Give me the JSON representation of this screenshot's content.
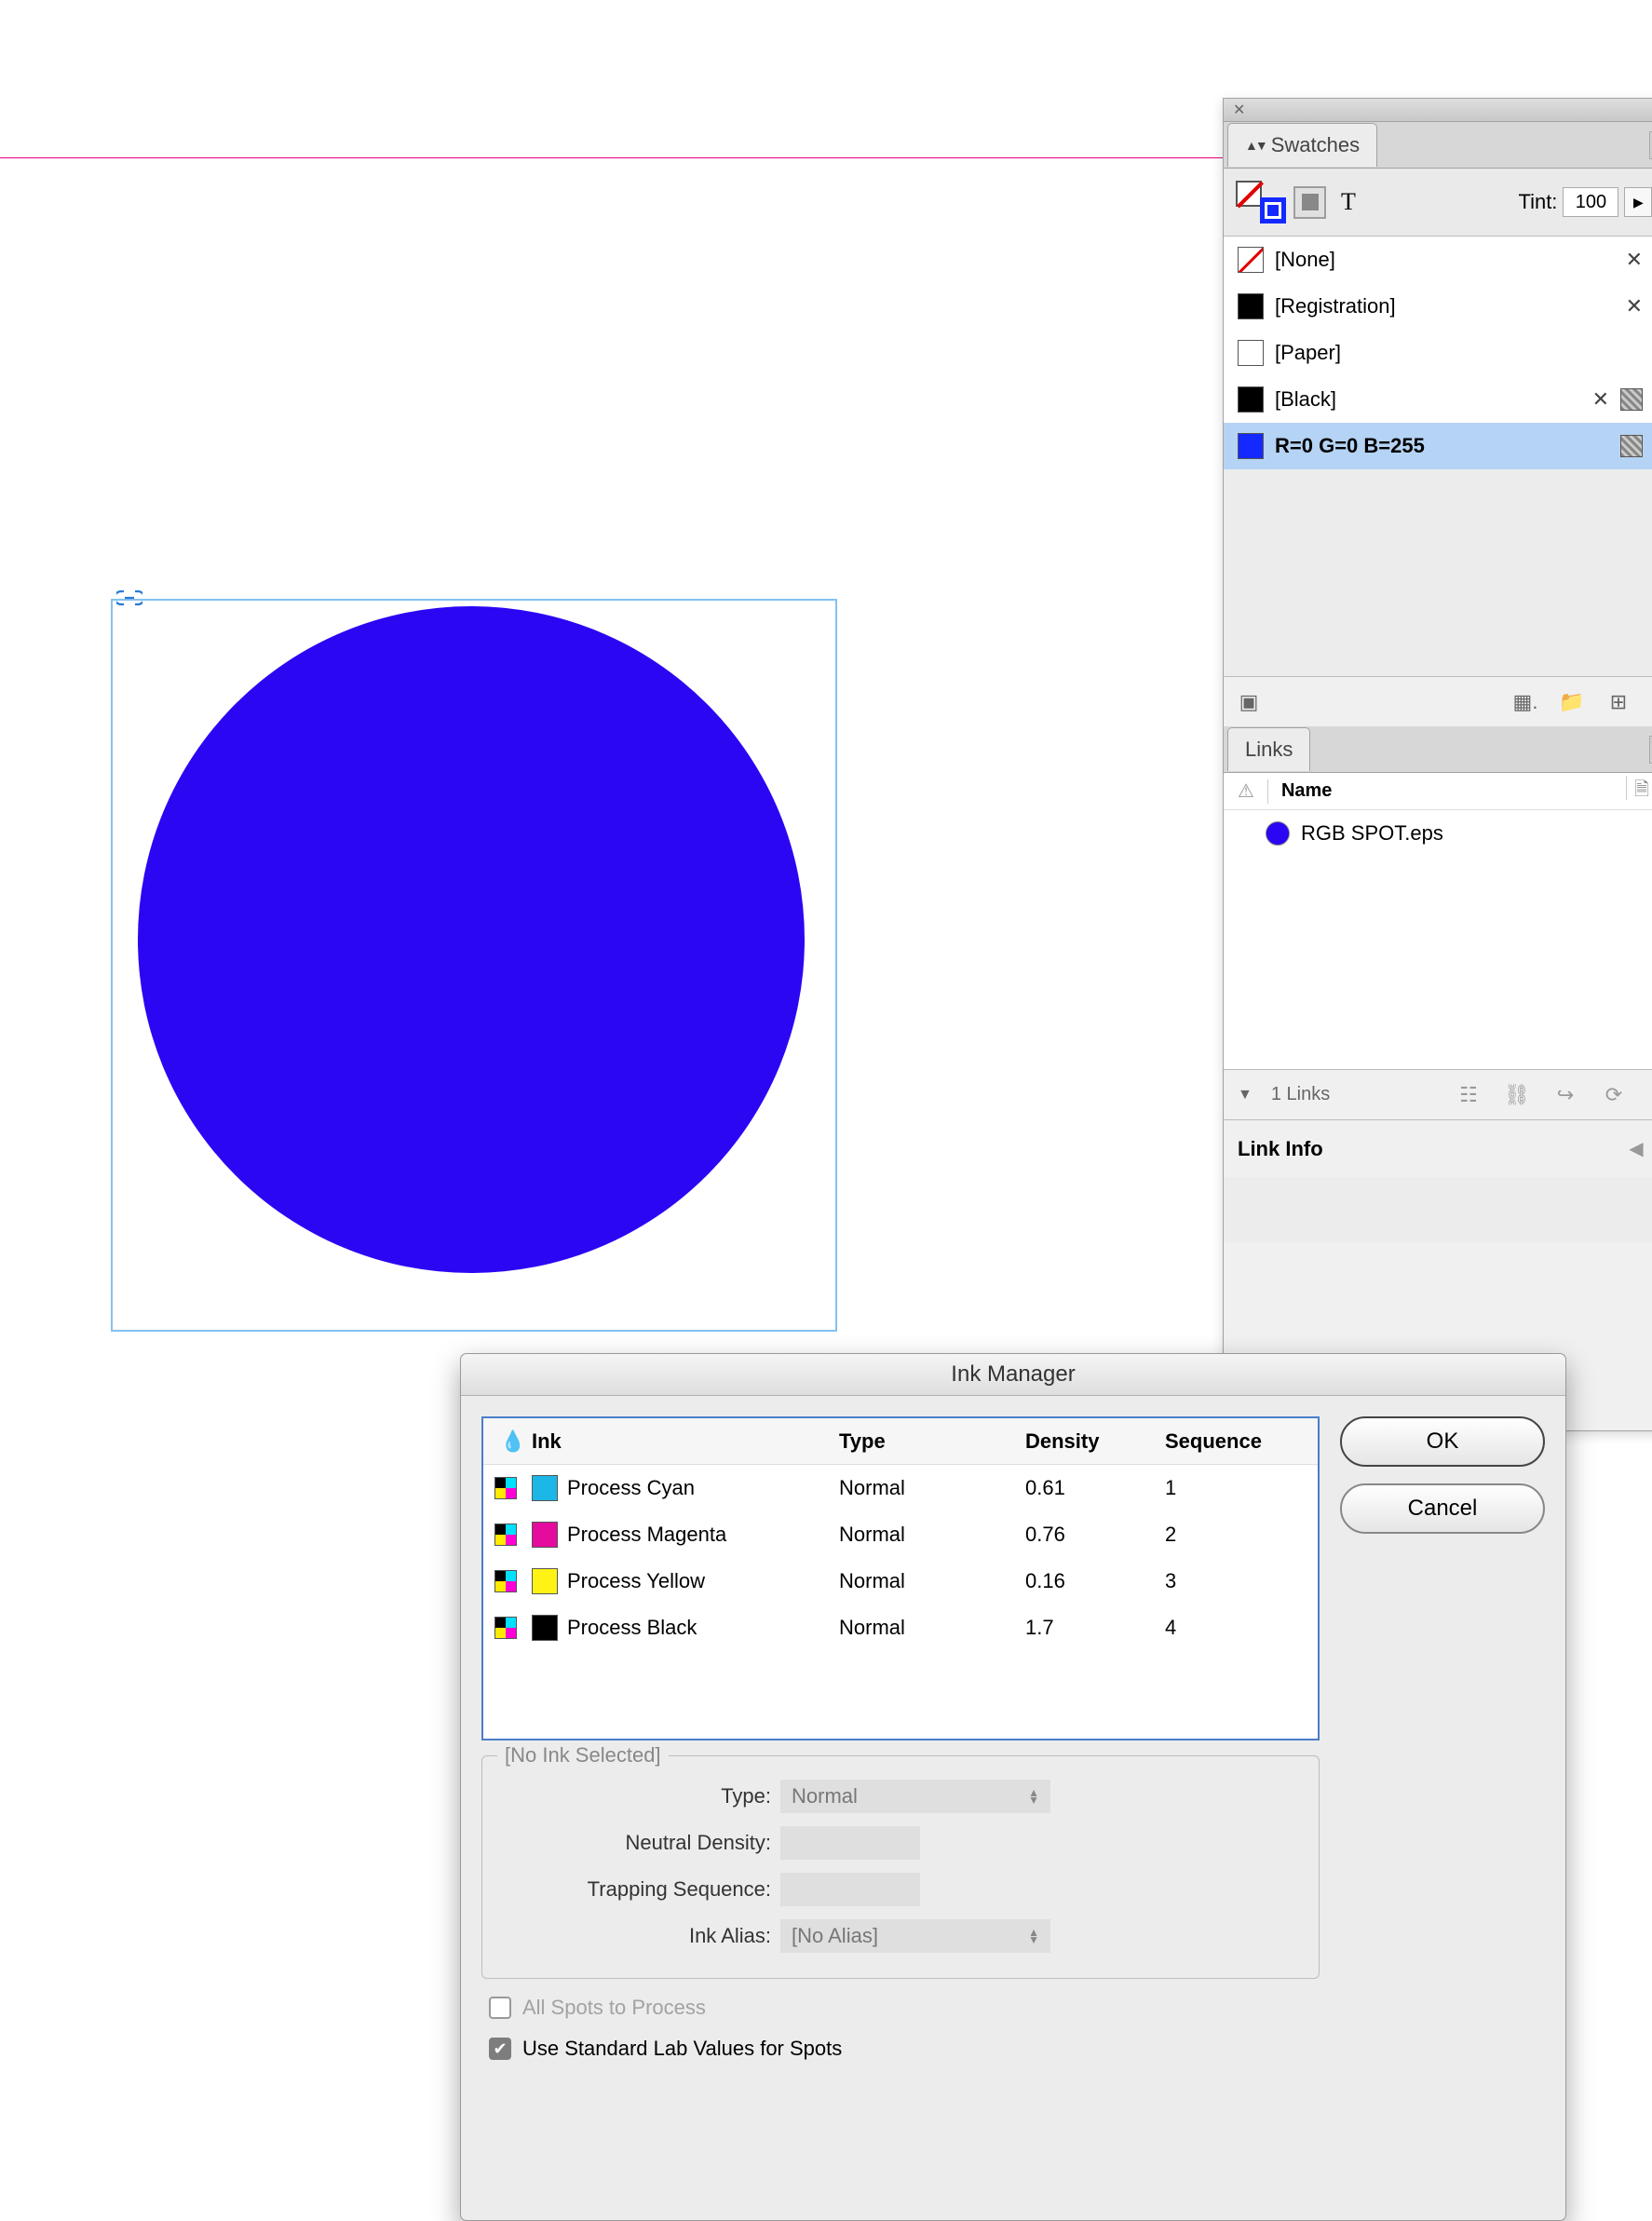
{
  "canvas": {
    "link_icon": "⧉"
  },
  "swatches_panel": {
    "tab_label": "Swatches",
    "tint_label": "Tint:",
    "tint_value": "100",
    "tint_unit": "%",
    "items": [
      {
        "name": "[None]"
      },
      {
        "name": "[Registration]"
      },
      {
        "name": "[Paper]"
      },
      {
        "name": "[Black]"
      },
      {
        "name": "R=0 G=0 B=255"
      }
    ]
  },
  "links_panel": {
    "tab_label": "Links",
    "name_col": "Name",
    "item": {
      "name": "RGB SPOT.eps",
      "count": "1"
    },
    "footer_count": "1 Links",
    "link_info": "Link Info"
  },
  "ink_manager": {
    "title": "Ink Manager",
    "ok": "OK",
    "cancel": "Cancel",
    "cols": {
      "ink": "Ink",
      "type": "Type",
      "density": "Density",
      "sequence": "Sequence"
    },
    "rows": [
      {
        "ink": "Process Cyan",
        "color": "#1cb7e6",
        "type": "Normal",
        "density": "0.61",
        "seq": "1"
      },
      {
        "ink": "Process Magenta",
        "color": "#e50b9d",
        "type": "Normal",
        "density": "0.76",
        "seq": "2"
      },
      {
        "ink": "Process Yellow",
        "color": "#fff215",
        "type": "Normal",
        "density": "0.16",
        "seq": "3"
      },
      {
        "ink": "Process Black",
        "color": "#000000",
        "type": "Normal",
        "density": "1.7",
        "seq": "4"
      }
    ],
    "no_ink_selected": "[No Ink Selected]",
    "labels": {
      "type": "Type:",
      "density": "Neutral Density:",
      "trap": "Trapping Sequence:",
      "alias": "Ink Alias:"
    },
    "values": {
      "type": "Normal",
      "alias": "[No Alias]"
    },
    "check1": "All Spots to Process",
    "check2": "Use Standard Lab Values for Spots"
  }
}
